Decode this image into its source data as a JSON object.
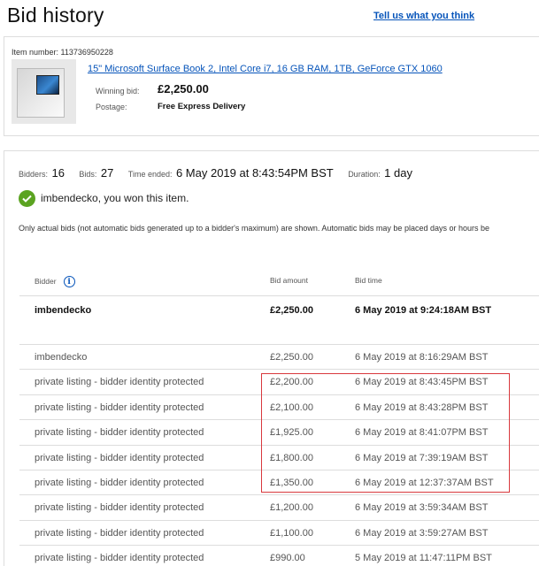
{
  "page": {
    "title": "Bid history",
    "feedback_link": "Tell us what you think"
  },
  "item": {
    "number_text": "Item number: 113736950228",
    "title": "15\" Microsoft Surface Book 2, Intel Core i7, 16 GB RAM, 1TB, GeForce GTX 1060",
    "winning_bid_label": "Winning bid:",
    "winning_bid_value": "£2,250.00",
    "postage_label": "Postage:",
    "postage_value": "Free Express Delivery"
  },
  "summary": {
    "bidders_label": "Bidders:",
    "bidders_value": "16",
    "bids_label": "Bids:",
    "bids_value": "27",
    "time_ended_label": "Time ended:",
    "time_ended_value": "6 May 2019 at 8:43:54PM BST",
    "duration_label": "Duration:",
    "duration_value": "1 day",
    "won_text": "imbendecko, you won this item.",
    "note": "Only actual bids (not automatic bids generated up to a bidder's maximum) are shown. Automatic bids may be placed days or hours be"
  },
  "table": {
    "headers": {
      "bidder": "Bidder",
      "amount": "Bid amount",
      "time": "Bid time"
    },
    "winner": {
      "bidder": "imbendecko",
      "amount": "£2,250.00",
      "time": "6 May 2019 at 9:24:18AM BST"
    },
    "rows": [
      {
        "bidder": "imbendecko",
        "amount": "£2,250.00",
        "time": "6 May 2019 at 8:16:29AM BST"
      },
      {
        "bidder": "private listing - bidder identity protected",
        "amount": "£2,200.00",
        "time": "6 May 2019 at 8:43:45PM BST"
      },
      {
        "bidder": "private listing - bidder identity protected",
        "amount": "£2,100.00",
        "time": "6 May 2019 at 8:43:28PM BST"
      },
      {
        "bidder": "private listing - bidder identity protected",
        "amount": "£1,925.00",
        "time": "6 May 2019 at 8:41:07PM BST"
      },
      {
        "bidder": "private listing - bidder identity protected",
        "amount": "£1,800.00",
        "time": "6 May 2019 at 7:39:19AM BST"
      },
      {
        "bidder": "private listing - bidder identity protected",
        "amount": "£1,350.00",
        "time": "6 May 2019 at 12:37:37AM BST"
      },
      {
        "bidder": "private listing - bidder identity protected",
        "amount": "£1,200.00",
        "time": "6 May 2019 at 3:59:34AM BST"
      },
      {
        "bidder": "private listing - bidder identity protected",
        "amount": "£1,100.00",
        "time": "6 May 2019 at 3:59:27AM BST"
      },
      {
        "bidder": "private listing - bidder identity protected",
        "amount": "£990.00",
        "time": "5 May 2019 at 11:47:11PM BST"
      }
    ]
  },
  "colors": {
    "link": "#0654ba",
    "success": "#5ba321",
    "highlight": "#d9383d"
  },
  "icons": {
    "info": "info-icon",
    "check": "check-circle-icon",
    "product": "product-thumbnail"
  }
}
